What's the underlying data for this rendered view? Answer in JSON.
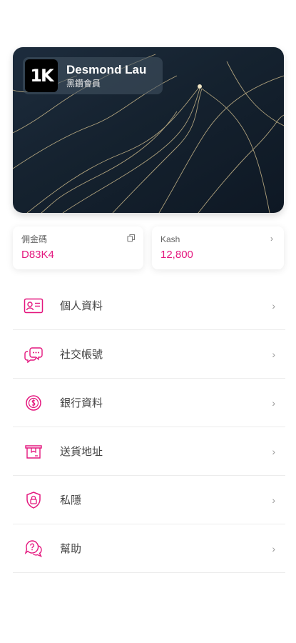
{
  "member": {
    "logo_text": "1K",
    "name": "Desmond Lau",
    "tier": "黑鑽會員"
  },
  "stats": [
    {
      "label": "佣金碼",
      "value": "D83K4",
      "icon": "copy-icon"
    },
    {
      "label": "Kash",
      "value": "12,800",
      "icon": "chevron-right-icon"
    }
  ],
  "menu": [
    {
      "label": "個人資料",
      "icon": "id-card-icon"
    },
    {
      "label": "社交帳號",
      "icon": "chat-bubbles-icon"
    },
    {
      "label": "銀行資料",
      "icon": "coin-icon"
    },
    {
      "label": "送貨地址",
      "icon": "package-icon"
    },
    {
      "label": "私隱",
      "icon": "shield-lock-icon"
    },
    {
      "label": "幫助",
      "icon": "help-chat-icon"
    }
  ],
  "colors": {
    "accent": "#e4177e",
    "card_bg": "#15222f"
  }
}
